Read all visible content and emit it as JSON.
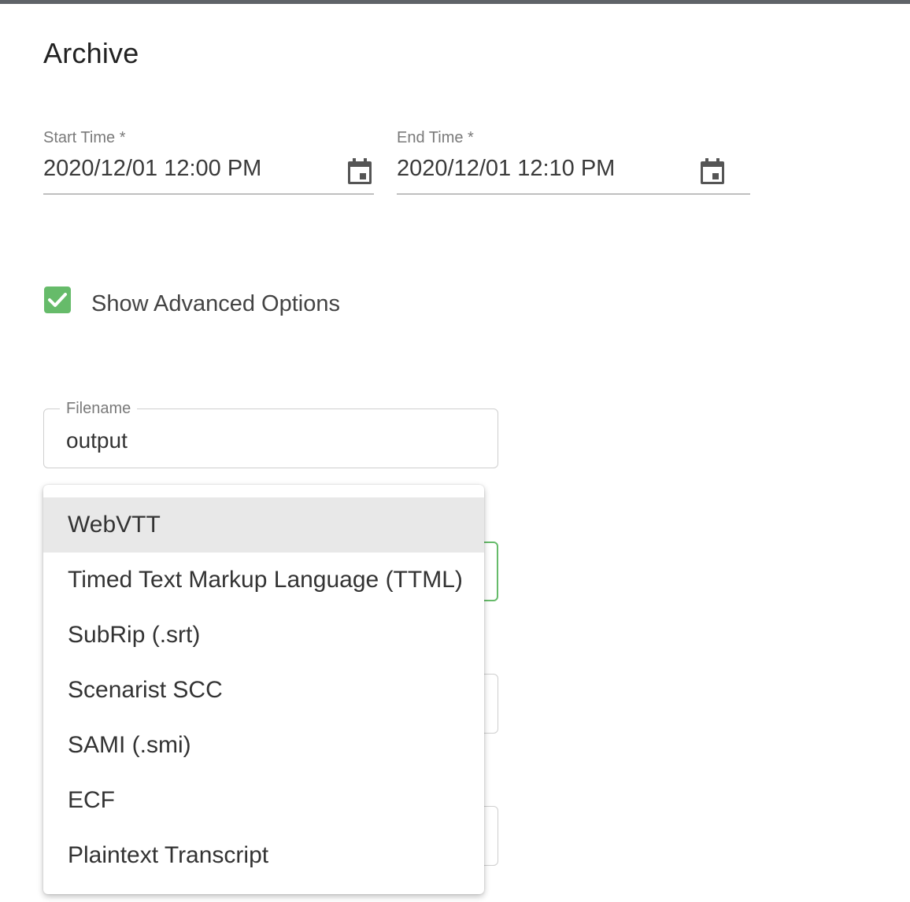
{
  "form": {
    "title": "Archive",
    "start_time": {
      "label": "Start Time *",
      "value": "2020/12/01 12:00 PM"
    },
    "end_time": {
      "label": "End Time *",
      "value": "2020/12/01 12:10 PM"
    },
    "advanced_options": {
      "label": "Show Advanced Options",
      "checked": true
    },
    "filename": {
      "label": "Filename",
      "value": "output"
    }
  },
  "format_dropdown": {
    "options": [
      "WebVTT",
      "Timed Text Markup Language (TTML)",
      "SubRip (.srt)",
      "Scenarist SCC",
      "SAMI (.smi)",
      "ECF",
      "Plaintext Transcript"
    ],
    "highlighted": "WebVTT"
  },
  "colors": {
    "accent": "#66bb6a",
    "top_rule": "#5f6368",
    "highlight": "#e8e8e8"
  },
  "icons": {
    "date_picker": "calendar-icon",
    "checkbox": "check-icon"
  }
}
